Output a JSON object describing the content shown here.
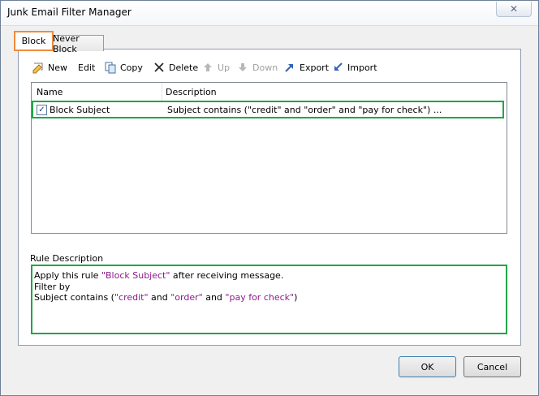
{
  "window": {
    "title": "Junk Email Filter Manager"
  },
  "tabs": [
    {
      "label": "Block",
      "active": true
    },
    {
      "label": "Never Block",
      "active": false
    }
  ],
  "toolbar": {
    "new": "New",
    "edit": "Edit",
    "copy": "Copy",
    "delete": "Delete",
    "up": "Up",
    "down": "Down",
    "export": "Export",
    "import": "Import"
  },
  "list": {
    "columns": [
      "Name",
      "Description"
    ],
    "rows": [
      {
        "checked": true,
        "name": "Block Subject",
        "description": "Subject contains (\"credit\" and \"order\" and \"pay for check\") ..."
      }
    ]
  },
  "rule_description": {
    "label": "Rule Description",
    "line1_prefix": "Apply this rule ",
    "line1_rule": "\"Block Subject\"",
    "line1_suffix": " after receiving message.",
    "line2": "Filter by",
    "line3_prefix": " Subject contains (",
    "term1": "\"credit\"",
    "and1": " and ",
    "term2": "\"order\"",
    "and2": " and ",
    "term3": "\"pay for check\"",
    "line3_suffix": ")"
  },
  "buttons": {
    "ok": "OK",
    "cancel": "Cancel"
  },
  "colors": {
    "highlight_green": "#22a547",
    "tab_orange": "#f18b3b",
    "quoted_purple": "#8b1a8b"
  }
}
